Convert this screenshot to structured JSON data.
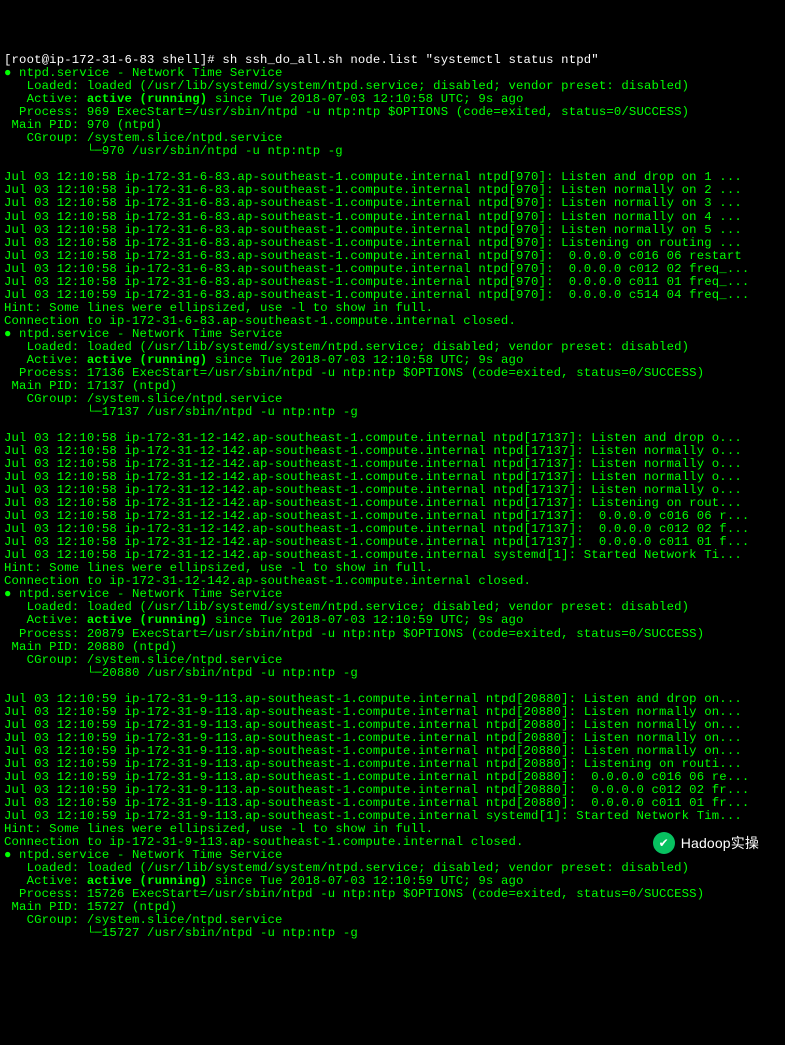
{
  "prompt": "[root@ip-172-31-6-83 shell]# sh ssh_do_all.sh node.list \"systemctl status ntpd\"",
  "watermark": "Hadoop实操",
  "blocks": [
    {
      "header": "● ntpd.service - Network Time Service",
      "loaded": "   Loaded: loaded (/usr/lib/systemd/system/ntpd.service; disabled; vendor preset: disabled)",
      "active_prefix": "   Active: ",
      "active_status": "active (running)",
      "active_suffix": " since Tue 2018-07-03 12:10:58 UTC; 9s ago",
      "process": "  Process: 969 ExecStart=/usr/sbin/ntpd -u ntp:ntp $OPTIONS (code=exited, status=0/SUCCESS)",
      "mainpid": " Main PID: 970 (ntpd)",
      "cgroup1": "   CGroup: /system.slice/ntpd.service",
      "cgroup2": "           └─970 /usr/sbin/ntpd -u ntp:ntp -g",
      "logs": [
        "Jul 03 12:10:58 ip-172-31-6-83.ap-southeast-1.compute.internal ntpd[970]: Listen and drop on 1 ...",
        "Jul 03 12:10:58 ip-172-31-6-83.ap-southeast-1.compute.internal ntpd[970]: Listen normally on 2 ...",
        "Jul 03 12:10:58 ip-172-31-6-83.ap-southeast-1.compute.internal ntpd[970]: Listen normally on 3 ...",
        "Jul 03 12:10:58 ip-172-31-6-83.ap-southeast-1.compute.internal ntpd[970]: Listen normally on 4 ...",
        "Jul 03 12:10:58 ip-172-31-6-83.ap-southeast-1.compute.internal ntpd[970]: Listen normally on 5 ...",
        "Jul 03 12:10:58 ip-172-31-6-83.ap-southeast-1.compute.internal ntpd[970]: Listening on routing ...",
        "Jul 03 12:10:58 ip-172-31-6-83.ap-southeast-1.compute.internal ntpd[970]:  0.0.0.0 c016 06 restart",
        "Jul 03 12:10:58 ip-172-31-6-83.ap-southeast-1.compute.internal ntpd[970]:  0.0.0.0 c012 02 freq_...",
        "Jul 03 12:10:58 ip-172-31-6-83.ap-southeast-1.compute.internal ntpd[970]:  0.0.0.0 c011 01 freq_...",
        "Jul 03 12:10:59 ip-172-31-6-83.ap-southeast-1.compute.internal ntpd[970]:  0.0.0.0 c514 04 freq_..."
      ],
      "hint": "Hint: Some lines were ellipsized, use -l to show in full.",
      "closed": "Connection to ip-172-31-6-83.ap-southeast-1.compute.internal closed."
    },
    {
      "header": "● ntpd.service - Network Time Service",
      "loaded": "   Loaded: loaded (/usr/lib/systemd/system/ntpd.service; disabled; vendor preset: disabled)",
      "active_prefix": "   Active: ",
      "active_status": "active (running)",
      "active_suffix": " since Tue 2018-07-03 12:10:58 UTC; 9s ago",
      "process": "  Process: 17136 ExecStart=/usr/sbin/ntpd -u ntp:ntp $OPTIONS (code=exited, status=0/SUCCESS)",
      "mainpid": " Main PID: 17137 (ntpd)",
      "cgroup1": "   CGroup: /system.slice/ntpd.service",
      "cgroup2": "           └─17137 /usr/sbin/ntpd -u ntp:ntp -g",
      "logs": [
        "Jul 03 12:10:58 ip-172-31-12-142.ap-southeast-1.compute.internal ntpd[17137]: Listen and drop o...",
        "Jul 03 12:10:58 ip-172-31-12-142.ap-southeast-1.compute.internal ntpd[17137]: Listen normally o...",
        "Jul 03 12:10:58 ip-172-31-12-142.ap-southeast-1.compute.internal ntpd[17137]: Listen normally o...",
        "Jul 03 12:10:58 ip-172-31-12-142.ap-southeast-1.compute.internal ntpd[17137]: Listen normally o...",
        "Jul 03 12:10:58 ip-172-31-12-142.ap-southeast-1.compute.internal ntpd[17137]: Listen normally o...",
        "Jul 03 12:10:58 ip-172-31-12-142.ap-southeast-1.compute.internal ntpd[17137]: Listening on rout...",
        "Jul 03 12:10:58 ip-172-31-12-142.ap-southeast-1.compute.internal ntpd[17137]:  0.0.0.0 c016 06 r...",
        "Jul 03 12:10:58 ip-172-31-12-142.ap-southeast-1.compute.internal ntpd[17137]:  0.0.0.0 c012 02 f...",
        "Jul 03 12:10:58 ip-172-31-12-142.ap-southeast-1.compute.internal ntpd[17137]:  0.0.0.0 c011 01 f...",
        "Jul 03 12:10:58 ip-172-31-12-142.ap-southeast-1.compute.internal systemd[1]: Started Network Ti..."
      ],
      "hint": "Hint: Some lines were ellipsized, use -l to show in full.",
      "closed": "Connection to ip-172-31-12-142.ap-southeast-1.compute.internal closed."
    },
    {
      "header": "● ntpd.service - Network Time Service",
      "loaded": "   Loaded: loaded (/usr/lib/systemd/system/ntpd.service; disabled; vendor preset: disabled)",
      "active_prefix": "   Active: ",
      "active_status": "active (running)",
      "active_suffix": " since Tue 2018-07-03 12:10:59 UTC; 9s ago",
      "process": "  Process: 20879 ExecStart=/usr/sbin/ntpd -u ntp:ntp $OPTIONS (code=exited, status=0/SUCCESS)",
      "mainpid": " Main PID: 20880 (ntpd)",
      "cgroup1": "   CGroup: /system.slice/ntpd.service",
      "cgroup2": "           └─20880 /usr/sbin/ntpd -u ntp:ntp -g",
      "logs": [
        "Jul 03 12:10:59 ip-172-31-9-113.ap-southeast-1.compute.internal ntpd[20880]: Listen and drop on...",
        "Jul 03 12:10:59 ip-172-31-9-113.ap-southeast-1.compute.internal ntpd[20880]: Listen normally on...",
        "Jul 03 12:10:59 ip-172-31-9-113.ap-southeast-1.compute.internal ntpd[20880]: Listen normally on...",
        "Jul 03 12:10:59 ip-172-31-9-113.ap-southeast-1.compute.internal ntpd[20880]: Listen normally on...",
        "Jul 03 12:10:59 ip-172-31-9-113.ap-southeast-1.compute.internal ntpd[20880]: Listen normally on...",
        "Jul 03 12:10:59 ip-172-31-9-113.ap-southeast-1.compute.internal ntpd[20880]: Listening on routi...",
        "Jul 03 12:10:59 ip-172-31-9-113.ap-southeast-1.compute.internal ntpd[20880]:  0.0.0.0 c016 06 re...",
        "Jul 03 12:10:59 ip-172-31-9-113.ap-southeast-1.compute.internal ntpd[20880]:  0.0.0.0 c012 02 fr...",
        "Jul 03 12:10:59 ip-172-31-9-113.ap-southeast-1.compute.internal ntpd[20880]:  0.0.0.0 c011 01 fr...",
        "Jul 03 12:10:59 ip-172-31-9-113.ap-southeast-1.compute.internal systemd[1]: Started Network Tim..."
      ],
      "hint": "Hint: Some lines were ellipsized, use -l to show in full.",
      "closed": "Connection to ip-172-31-9-113.ap-southeast-1.compute.internal closed."
    },
    {
      "header": "● ntpd.service - Network Time Service",
      "loaded": "   Loaded: loaded (/usr/lib/systemd/system/ntpd.service; disabled; vendor preset: disabled)",
      "active_prefix": "   Active: ",
      "active_status": "active (running)",
      "active_suffix": " since Tue 2018-07-03 12:10:59 UTC; 9s ago",
      "process": "  Process: 15726 ExecStart=/usr/sbin/ntpd -u ntp:ntp $OPTIONS (code=exited, status=0/SUCCESS)",
      "mainpid": " Main PID: 15727 (ntpd)",
      "cgroup1": "   CGroup: /system.slice/ntpd.service",
      "cgroup2": "           └─15727 /usr/sbin/ntpd -u ntp:ntp -g",
      "logs": [],
      "hint": "",
      "closed": ""
    }
  ]
}
